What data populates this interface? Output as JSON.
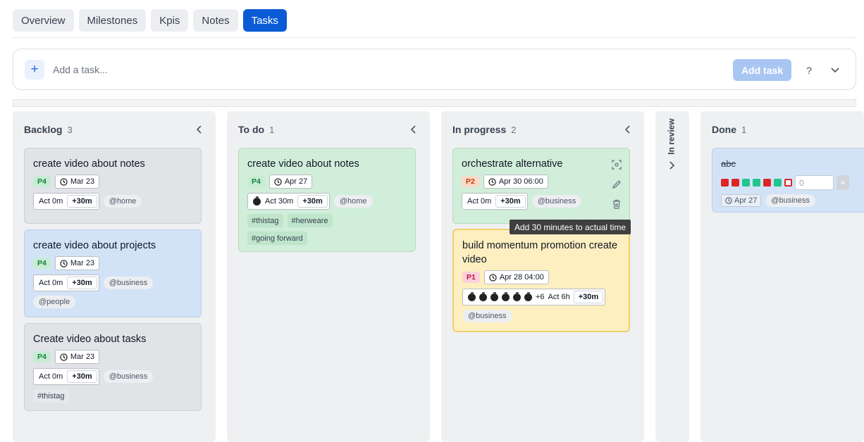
{
  "tabs": [
    "Overview",
    "Milestones",
    "Kpis",
    "Notes",
    "Tasks"
  ],
  "add_task": {
    "placeholder": "Add a task...",
    "button": "Add task",
    "help": "?"
  },
  "tooltip": "Add 30 minutes to actual time",
  "plus30": "+30m",
  "columns": {
    "backlog": {
      "title": "Backlog",
      "count": "3",
      "cards": [
        {
          "title": "create video about notes",
          "priority": "P4",
          "date": "Mar 23",
          "act": "Act 0m",
          "context": "@home"
        },
        {
          "title": "create video about projects",
          "priority": "P4",
          "date": "Mar 23",
          "act": "Act 0m",
          "context": "@business",
          "context2": "@people"
        },
        {
          "title": "Create video about tasks",
          "priority": "P4",
          "date": "Mar 23",
          "act": "Act 0m",
          "context": "@business",
          "tags": [
            "#thistag"
          ]
        }
      ]
    },
    "todo": {
      "title": "To do",
      "count": "1",
      "cards": [
        {
          "title": "create video about notes",
          "priority": "P4",
          "date": "Apr 27",
          "act": "Act 30m",
          "pomodoros": 1,
          "context": "@home",
          "tags": [
            "#thistag",
            "#herweare",
            "#going forward"
          ]
        }
      ]
    },
    "inprogress": {
      "title": "In progress",
      "count": "2",
      "cards": [
        {
          "title": "orchestrate alternative",
          "priority": "P2",
          "date": "Apr 30 06:00",
          "act": "Act 0m",
          "context": "@business"
        },
        {
          "title": "build momentum promotion create video",
          "priority": "P1",
          "date": "Apr 28 04:00",
          "pomodoros": 6,
          "extra": "+6",
          "act": "Act 6h",
          "context": "@business"
        }
      ]
    },
    "inreview": {
      "title": "In review"
    },
    "done": {
      "title": "Done",
      "count": "1",
      "cards": [
        {
          "title": "abc",
          "input_value": "0",
          "date": "Apr 27",
          "context": "@business",
          "squares": [
            "red",
            "red",
            "green",
            "green",
            "red",
            "green",
            "red-outline"
          ]
        }
      ]
    }
  },
  "colors": {
    "accent": "#0b5bd6",
    "add_button": "#a9c6f2"
  },
  "icons": [
    "plus-icon",
    "chevron-down-icon",
    "chevron-left-icon",
    "chevron-right-icon",
    "clock-icon",
    "focus-icon",
    "pencil-icon",
    "trash-icon",
    "tomato-icon"
  ]
}
